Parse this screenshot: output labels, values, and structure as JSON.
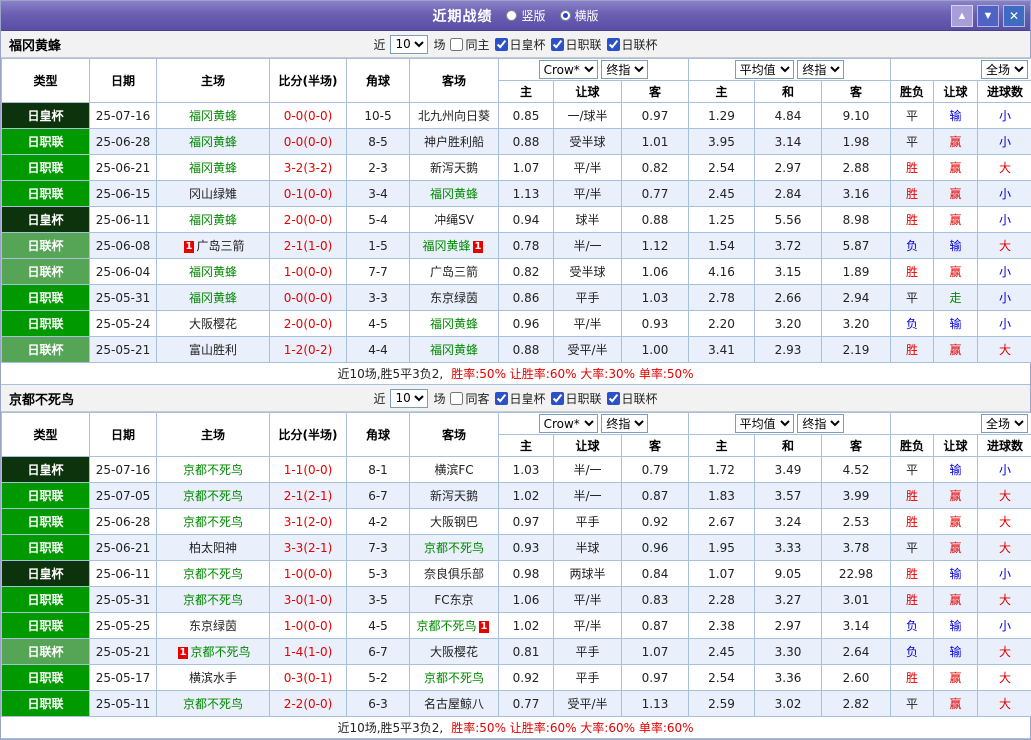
{
  "titlebar": {
    "title": "近期战绩",
    "radios": [
      {
        "label": "竖版",
        "selected": false
      },
      {
        "label": "横版",
        "selected": true
      }
    ],
    "buttons": {
      "up": "▲",
      "down": "▼",
      "close": "✕"
    }
  },
  "filter": {
    "near": "近",
    "count": "10",
    "games": "场"
  },
  "table_header": {
    "static_cols": [
      "类型",
      "日期",
      "主场",
      "比分(半场)",
      "角球",
      "客场"
    ],
    "odds1": {
      "selects": [
        "Crow*",
        "终指"
      ],
      "cols": [
        "主",
        "让球",
        "客"
      ]
    },
    "odds2": {
      "selects": [
        "平均值",
        "终指"
      ],
      "cols": [
        "主",
        "和",
        "客"
      ]
    },
    "result_col": "胜负",
    "full_select": "全场",
    "tail_cols": [
      "让球",
      "进球数"
    ]
  },
  "sections": [
    {
      "team": "福冈黄蜂",
      "same_label": "同主",
      "cups": [
        "日皇杯",
        "日职联",
        "日联杯"
      ],
      "rows": [
        {
          "type": "日皇杯",
          "date": "25-07-16",
          "home": "福冈黄蜂",
          "hf": true,
          "hc": false,
          "score": "0-0(0-0)",
          "corner": "10-5",
          "away": "北九州向日葵",
          "af": false,
          "ac": false,
          "o1": [
            "0.85",
            "一/球半",
            "0.97"
          ],
          "o2": [
            "1.29",
            "4.84",
            "9.10"
          ],
          "res": "平",
          "hcp": "输",
          "goal": "小"
        },
        {
          "type": "日职联",
          "date": "25-06-28",
          "home": "福冈黄蜂",
          "hf": true,
          "hc": false,
          "score": "0-0(0-0)",
          "corner": "8-5",
          "away": "神户胜利船",
          "af": false,
          "ac": false,
          "o1": [
            "0.88",
            "受半球",
            "1.01"
          ],
          "o2": [
            "3.95",
            "3.14",
            "1.98"
          ],
          "res": "平",
          "hcp": "赢",
          "goal": "小"
        },
        {
          "type": "日职联",
          "date": "25-06-21",
          "home": "福冈黄蜂",
          "hf": true,
          "hc": false,
          "score": "3-2(3-2)",
          "corner": "2-3",
          "away": "新泻天鹅",
          "af": false,
          "ac": false,
          "o1": [
            "1.07",
            "平/半",
            "0.82"
          ],
          "o2": [
            "2.54",
            "2.97",
            "2.88"
          ],
          "res": "胜",
          "hcp": "赢",
          "goal": "大"
        },
        {
          "type": "日职联",
          "date": "25-06-15",
          "home": "冈山绿雉",
          "hf": false,
          "hc": false,
          "score": "0-1(0-0)",
          "corner": "3-4",
          "away": "福冈黄蜂",
          "af": true,
          "ac": false,
          "o1": [
            "1.13",
            "平/半",
            "0.77"
          ],
          "o2": [
            "2.45",
            "2.84",
            "3.16"
          ],
          "res": "胜",
          "hcp": "赢",
          "goal": "小"
        },
        {
          "type": "日皇杯",
          "date": "25-06-11",
          "home": "福冈黄蜂",
          "hf": true,
          "hc": false,
          "score": "2-0(0-0)",
          "corner": "5-4",
          "away": "冲绳SV",
          "af": false,
          "ac": false,
          "o1": [
            "0.94",
            "球半",
            "0.88"
          ],
          "o2": [
            "1.25",
            "5.56",
            "8.98"
          ],
          "res": "胜",
          "hcp": "赢",
          "goal": "小"
        },
        {
          "type": "日联杯",
          "date": "25-06-08",
          "home": "广岛三箭",
          "hf": false,
          "hc": true,
          "score": "2-1(1-0)",
          "corner": "1-5",
          "away": "福冈黄蜂",
          "af": true,
          "ac": true,
          "o1": [
            "0.78",
            "半/一",
            "1.12"
          ],
          "o2": [
            "1.54",
            "3.72",
            "5.87"
          ],
          "res": "负",
          "hcp": "输",
          "goal": "大"
        },
        {
          "type": "日联杯",
          "date": "25-06-04",
          "home": "福冈黄蜂",
          "hf": true,
          "hc": false,
          "score": "1-0(0-0)",
          "corner": "7-7",
          "away": "广岛三箭",
          "af": false,
          "ac": false,
          "o1": [
            "0.82",
            "受半球",
            "1.06"
          ],
          "o2": [
            "4.16",
            "3.15",
            "1.89"
          ],
          "res": "胜",
          "hcp": "赢",
          "goal": "小"
        },
        {
          "type": "日职联",
          "date": "25-05-31",
          "home": "福冈黄蜂",
          "hf": true,
          "hc": false,
          "score": "0-0(0-0)",
          "corner": "3-3",
          "away": "东京绿茵",
          "af": false,
          "ac": false,
          "o1": [
            "0.86",
            "平手",
            "1.03"
          ],
          "o2": [
            "2.78",
            "2.66",
            "2.94"
          ],
          "res": "平",
          "hcp": "走",
          "goal": "小"
        },
        {
          "type": "日职联",
          "date": "25-05-24",
          "home": "大阪樱花",
          "hf": false,
          "hc": false,
          "score": "2-0(0-0)",
          "corner": "4-5",
          "away": "福冈黄蜂",
          "af": true,
          "ac": false,
          "o1": [
            "0.96",
            "平/半",
            "0.93"
          ],
          "o2": [
            "2.20",
            "3.20",
            "3.20"
          ],
          "res": "负",
          "hcp": "输",
          "goal": "小"
        },
        {
          "type": "日联杯",
          "date": "25-05-21",
          "home": "富山胜利",
          "hf": false,
          "hc": false,
          "score": "1-2(0-2)",
          "corner": "4-4",
          "away": "福冈黄蜂",
          "af": true,
          "ac": false,
          "o1": [
            "0.88",
            "受平/半",
            "1.00"
          ],
          "o2": [
            "3.41",
            "2.93",
            "2.19"
          ],
          "res": "胜",
          "hcp": "赢",
          "goal": "大"
        }
      ],
      "footer_black": "近10场,胜5平3负2,",
      "footer_red": "胜率:50%  让胜率:60%  大率:30%  单率:50%"
    },
    {
      "team": "京都不死鸟",
      "same_label": "同客",
      "cups": [
        "日皇杯",
        "日职联",
        "日联杯"
      ],
      "rows": [
        {
          "type": "日皇杯",
          "date": "25-07-16",
          "home": "京都不死鸟",
          "hf": true,
          "hc": false,
          "score": "1-1(0-0)",
          "corner": "8-1",
          "away": "横滨FC",
          "af": false,
          "ac": false,
          "o1": [
            "1.03",
            "半/一",
            "0.79"
          ],
          "o2": [
            "1.72",
            "3.49",
            "4.52"
          ],
          "res": "平",
          "hcp": "输",
          "goal": "小"
        },
        {
          "type": "日职联",
          "date": "25-07-05",
          "home": "京都不死鸟",
          "hf": true,
          "hc": false,
          "score": "2-1(2-1)",
          "corner": "6-7",
          "away": "新泻天鹅",
          "af": false,
          "ac": false,
          "o1": [
            "1.02",
            "半/一",
            "0.87"
          ],
          "o2": [
            "1.83",
            "3.57",
            "3.99"
          ],
          "res": "胜",
          "hcp": "赢",
          "goal": "大"
        },
        {
          "type": "日职联",
          "date": "25-06-28",
          "home": "京都不死鸟",
          "hf": true,
          "hc": false,
          "score": "3-1(2-0)",
          "corner": "4-2",
          "away": "大阪钢巴",
          "af": false,
          "ac": false,
          "o1": [
            "0.97",
            "平手",
            "0.92"
          ],
          "o2": [
            "2.67",
            "3.24",
            "2.53"
          ],
          "res": "胜",
          "hcp": "赢",
          "goal": "大"
        },
        {
          "type": "日职联",
          "date": "25-06-21",
          "home": "柏太阳神",
          "hf": false,
          "hc": false,
          "score": "3-3(2-1)",
          "corner": "7-3",
          "away": "京都不死鸟",
          "af": true,
          "ac": false,
          "o1": [
            "0.93",
            "半球",
            "0.96"
          ],
          "o2": [
            "1.95",
            "3.33",
            "3.78"
          ],
          "res": "平",
          "hcp": "赢",
          "goal": "大"
        },
        {
          "type": "日皇杯",
          "date": "25-06-11",
          "home": "京都不死鸟",
          "hf": true,
          "hc": false,
          "score": "1-0(0-0)",
          "corner": "5-3",
          "away": "奈良俱乐部",
          "af": false,
          "ac": false,
          "o1": [
            "0.98",
            "两球半",
            "0.84"
          ],
          "o2": [
            "1.07",
            "9.05",
            "22.98"
          ],
          "res": "胜",
          "hcp": "输",
          "goal": "小"
        },
        {
          "type": "日职联",
          "date": "25-05-31",
          "home": "京都不死鸟",
          "hf": true,
          "hc": false,
          "score": "3-0(1-0)",
          "corner": "3-5",
          "away": "FC东京",
          "af": false,
          "ac": false,
          "o1": [
            "1.06",
            "平/半",
            "0.83"
          ],
          "o2": [
            "2.28",
            "3.27",
            "3.01"
          ],
          "res": "胜",
          "hcp": "赢",
          "goal": "大"
        },
        {
          "type": "日职联",
          "date": "25-05-25",
          "home": "东京绿茵",
          "hf": false,
          "hc": false,
          "score": "1-0(0-0)",
          "corner": "4-5",
          "away": "京都不死鸟",
          "af": true,
          "ac": true,
          "o1": [
            "1.02",
            "平/半",
            "0.87"
          ],
          "o2": [
            "2.38",
            "2.97",
            "3.14"
          ],
          "res": "负",
          "hcp": "输",
          "goal": "小"
        },
        {
          "type": "日联杯",
          "date": "25-05-21",
          "home": "京都不死鸟",
          "hf": true,
          "hc": true,
          "score": "1-4(1-0)",
          "corner": "6-7",
          "away": "大阪樱花",
          "af": false,
          "ac": false,
          "o1": [
            "0.81",
            "平手",
            "1.07"
          ],
          "o2": [
            "2.45",
            "3.30",
            "2.64"
          ],
          "res": "负",
          "hcp": "输",
          "goal": "大"
        },
        {
          "type": "日职联",
          "date": "25-05-17",
          "home": "横滨水手",
          "hf": false,
          "hc": false,
          "score": "0-3(0-1)",
          "corner": "5-2",
          "away": "京都不死鸟",
          "af": true,
          "ac": false,
          "o1": [
            "0.92",
            "平手",
            "0.97"
          ],
          "o2": [
            "2.54",
            "3.36",
            "2.60"
          ],
          "res": "胜",
          "hcp": "赢",
          "goal": "大"
        },
        {
          "type": "日职联",
          "date": "25-05-11",
          "home": "京都不死鸟",
          "hf": true,
          "hc": false,
          "score": "2-2(0-0)",
          "corner": "6-3",
          "away": "名古屋鲸八",
          "af": false,
          "ac": false,
          "o1": [
            "0.77",
            "受平/半",
            "1.13"
          ],
          "o2": [
            "2.59",
            "3.02",
            "2.82"
          ],
          "res": "平",
          "hcp": "赢",
          "goal": "大"
        }
      ],
      "footer_black": "近10场,胜5平3负2,",
      "footer_red": "胜率:50%  让胜率:60%  大率:60%  单率:60%"
    }
  ]
}
